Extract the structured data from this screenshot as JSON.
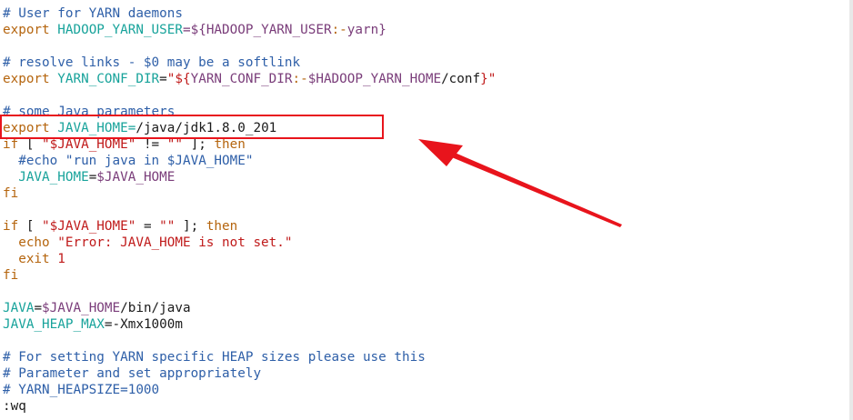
{
  "editor": {
    "lines": [
      [
        {
          "t": "# User for YARN daemons",
          "c": "c"
        }
      ],
      [
        {
          "t": "export ",
          "c": "k"
        },
        {
          "t": "HADOOP_YARN_USER",
          "c": "v"
        },
        {
          "t": "=${",
          "c": "x"
        },
        {
          "t": "HADOOP_YARN_USER",
          "c": "x"
        },
        {
          "t": ":-",
          "c": "k"
        },
        {
          "t": "yarn",
          "c": "x"
        },
        {
          "t": "}",
          "c": "x"
        }
      ],
      [],
      [
        {
          "t": "# resolve links - $0 may be a softlink",
          "c": "c"
        }
      ],
      [
        {
          "t": "export ",
          "c": "k"
        },
        {
          "t": "YARN_CONF_DIR",
          "c": "v"
        },
        {
          "t": "=",
          "c": "t"
        },
        {
          "t": "\"${",
          "c": "s"
        },
        {
          "t": "YARN_CONF_DIR",
          "c": "x"
        },
        {
          "t": ":-",
          "c": "k"
        },
        {
          "t": "$HADOOP_YARN_HOME",
          "c": "x"
        },
        {
          "t": "/conf",
          "c": "t"
        },
        {
          "t": "}\"",
          "c": "s"
        }
      ],
      [],
      [
        {
          "t": "# some Java parameters",
          "c": "c"
        }
      ],
      [
        {
          "t": "export ",
          "c": "k"
        },
        {
          "t": "JAVA_HOME",
          "c": "v"
        },
        {
          "t": "=",
          "c": "v"
        },
        {
          "t": "/java/jdk1.8.0_201",
          "c": "t"
        }
      ],
      [
        {
          "t": "if",
          "c": "k"
        },
        {
          "t": " [ ",
          "c": "t"
        },
        {
          "t": "\"$JAVA_HOME\"",
          "c": "s"
        },
        {
          "t": " != ",
          "c": "t"
        },
        {
          "t": "\"\"",
          "c": "s"
        },
        {
          "t": " ]; ",
          "c": "t"
        },
        {
          "t": "then",
          "c": "k"
        }
      ],
      [
        {
          "t": "  ",
          "c": "t"
        },
        {
          "t": "#echo \"run java in $JAVA_HOME\"",
          "c": "c"
        }
      ],
      [
        {
          "t": "  ",
          "c": "t"
        },
        {
          "t": "JAVA_HOME",
          "c": "v"
        },
        {
          "t": "=",
          "c": "t"
        },
        {
          "t": "$JAVA_HOME",
          "c": "x"
        }
      ],
      [
        {
          "t": "fi",
          "c": "k"
        }
      ],
      [],
      [
        {
          "t": "if",
          "c": "k"
        },
        {
          "t": " [ ",
          "c": "t"
        },
        {
          "t": "\"$JAVA_HOME\"",
          "c": "s"
        },
        {
          "t": " = ",
          "c": "t"
        },
        {
          "t": "\"\"",
          "c": "s"
        },
        {
          "t": " ]; ",
          "c": "t"
        },
        {
          "t": "then",
          "c": "k"
        }
      ],
      [
        {
          "t": "  ",
          "c": "t"
        },
        {
          "t": "echo ",
          "c": "k"
        },
        {
          "t": "\"Error: JAVA_HOME is not set.\"",
          "c": "s"
        }
      ],
      [
        {
          "t": "  ",
          "c": "t"
        },
        {
          "t": "exit ",
          "c": "k"
        },
        {
          "t": "1",
          "c": "s"
        }
      ],
      [
        {
          "t": "fi",
          "c": "k"
        }
      ],
      [],
      [
        {
          "t": "JAVA",
          "c": "v"
        },
        {
          "t": "=",
          "c": "t"
        },
        {
          "t": "$JAVA_HOME",
          "c": "x"
        },
        {
          "t": "/bin/java",
          "c": "t"
        }
      ],
      [
        {
          "t": "JAVA_HEAP_MAX",
          "c": "v"
        },
        {
          "t": "=",
          "c": "t"
        },
        {
          "t": "-Xmx1000m",
          "c": "t"
        }
      ],
      [],
      [
        {
          "t": "# For setting YARN specific HEAP sizes please use this",
          "c": "c"
        }
      ],
      [
        {
          "t": "# Parameter and set appropriately",
          "c": "c"
        }
      ],
      [
        {
          "t": "# YARN_HEAPSIZE=1000",
          "c": "c"
        }
      ],
      [
        {
          "t": ":wq",
          "c": "t"
        }
      ]
    ]
  },
  "annotation": {
    "color": "#e8141c"
  }
}
